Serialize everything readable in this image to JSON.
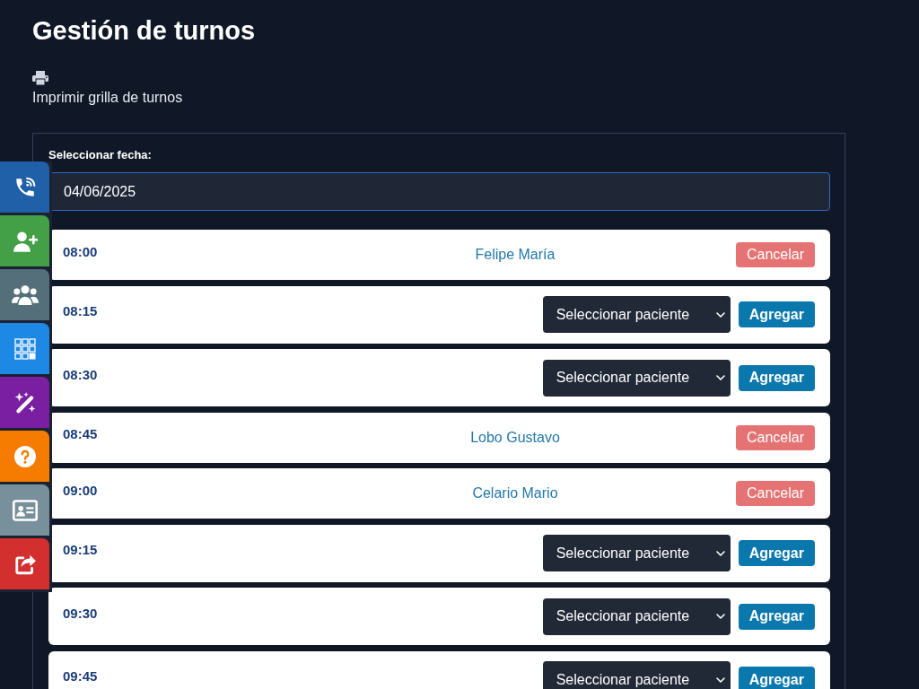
{
  "page": {
    "title": "Gestión de turnos"
  },
  "print_link": {
    "label": "Imprimir grilla de turnos"
  },
  "date_picker": {
    "label": "Seleccionar fecha:",
    "value": "04/06/2025"
  },
  "slots": [
    {
      "kind": "booked",
      "time": "08:00",
      "patient": "Felipe María",
      "action": "Cancelar"
    },
    {
      "kind": "open",
      "time": "08:15",
      "select": "Seleccionar paciente",
      "action": "Agregar"
    },
    {
      "kind": "open",
      "time": "08:30",
      "select": "Seleccionar paciente",
      "action": "Agregar"
    },
    {
      "kind": "booked",
      "time": "08:45",
      "patient": "Lobo Gustavo",
      "action": "Cancelar"
    },
    {
      "kind": "booked",
      "time": "09:00",
      "patient": "Celario Mario",
      "action": "Cancelar"
    },
    {
      "kind": "open",
      "time": "09:15",
      "select": "Seleccionar paciente",
      "action": "Agregar"
    },
    {
      "kind": "open",
      "time": "09:30",
      "select": "Seleccionar paciente",
      "action": "Agregar"
    },
    {
      "kind": "open",
      "time": "09:45",
      "select": "Seleccionar paciente",
      "action": "Agregar"
    }
  ],
  "side_menu": [
    {
      "color": "#1f60a8"
    },
    {
      "color": "#43a047"
    },
    {
      "color": "#546e7a"
    },
    {
      "color": "#1e88e5"
    },
    {
      "color": "#7b1fa2"
    },
    {
      "color": "#f57c00"
    },
    {
      "color": "#78909c"
    },
    {
      "color": "#d32f2f"
    }
  ]
}
